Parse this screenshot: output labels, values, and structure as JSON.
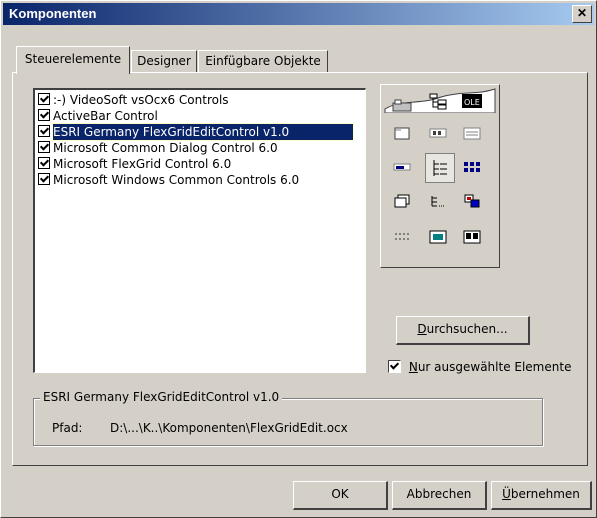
{
  "window": {
    "title": "Komponenten",
    "close_glyph": "✕"
  },
  "tabs": [
    {
      "label": "Steuerelemente",
      "active": true
    },
    {
      "label": "Designer",
      "active": false
    },
    {
      "label": "Einfügbare Objekte",
      "active": false
    }
  ],
  "components": [
    {
      "label": ":-) VideoSoft vsOcx6 Controls",
      "checked": true
    },
    {
      "label": "ActiveBar Control",
      "checked": true
    },
    {
      "label": "ESRI Germany FlexGridEditControl v1.0",
      "checked": true,
      "selected": true
    },
    {
      "label": "Microsoft Common Dialog Control 6.0",
      "checked": true
    },
    {
      "label": "Microsoft FlexGrid Control 6.0",
      "checked": true
    },
    {
      "label": "Microsoft Windows Common Controls 6.0",
      "checked": true
    }
  ],
  "preview_icons": [
    "ole-icon",
    "tabstrip-icon",
    "toolbar-icon",
    "statusbar-icon",
    "progressbar-icon",
    "treeview-icon",
    "listview-icon",
    "imagelist-icon",
    "slider-icon",
    "imagecombo-icon",
    "animation-icon",
    "datetime-icon",
    "monthview-icon",
    "flatscrollbar-icon",
    "updown-icon"
  ],
  "browse_button": {
    "prefix": "",
    "mnemonic": "D",
    "rest": "urchsuchen..."
  },
  "only_selected": {
    "checked": true,
    "mnemonic": "N",
    "rest": "ur ausgewählte Elemente"
  },
  "details": {
    "group_title": "ESRI Germany FlexGridEditControl v1.0",
    "path_label": "Pfad:",
    "path_value": "D:\\...\\K..\\Komponenten\\FlexGridEdit.ocx"
  },
  "buttons": {
    "ok": "OK",
    "cancel": "Abbrechen",
    "apply_mnemonic": "Ü",
    "apply_rest": "bernehmen"
  },
  "colors": {
    "title_bar": "#0a246a",
    "face": "#d4d0c8",
    "selection": "#0a246a"
  }
}
